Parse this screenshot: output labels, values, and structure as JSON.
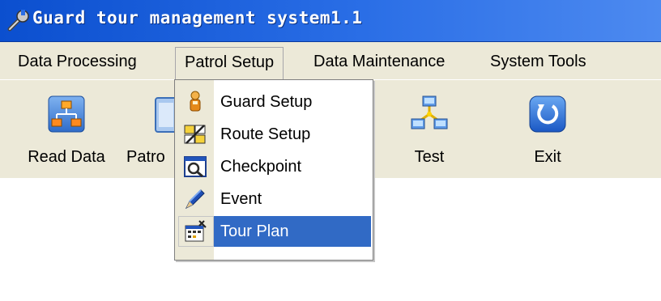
{
  "window": {
    "title": "Guard tour management system1.1",
    "icon": "wrench-icon"
  },
  "menubar": {
    "items": [
      {
        "label": "Data Processing"
      },
      {
        "label": "Patrol Setup",
        "open": true
      },
      {
        "label": "Data Maintenance"
      },
      {
        "label": "System Tools"
      }
    ]
  },
  "toolbar": {
    "buttons": [
      {
        "label": "Read Data",
        "icon": "org-chart-icon"
      },
      {
        "label": "Patro",
        "icon": "document-icon"
      },
      {
        "label": "Test",
        "icon": "network-icon"
      },
      {
        "label": "Exit",
        "icon": "exit-icon"
      }
    ]
  },
  "dropdown": {
    "items": [
      {
        "label": "Guard Setup",
        "icon": "guard-icon"
      },
      {
        "label": "Route Setup",
        "icon": "route-icon"
      },
      {
        "label": "Checkpoint",
        "icon": "checkpoint-icon"
      },
      {
        "label": "Event",
        "icon": "pen-icon"
      },
      {
        "label": "Tour Plan",
        "icon": "tour-plan-icon",
        "selected": true
      }
    ]
  },
  "colors": {
    "titlebar": "#0b4fcf",
    "menu_bg": "#ece9d8",
    "highlight": "#316ac5"
  }
}
